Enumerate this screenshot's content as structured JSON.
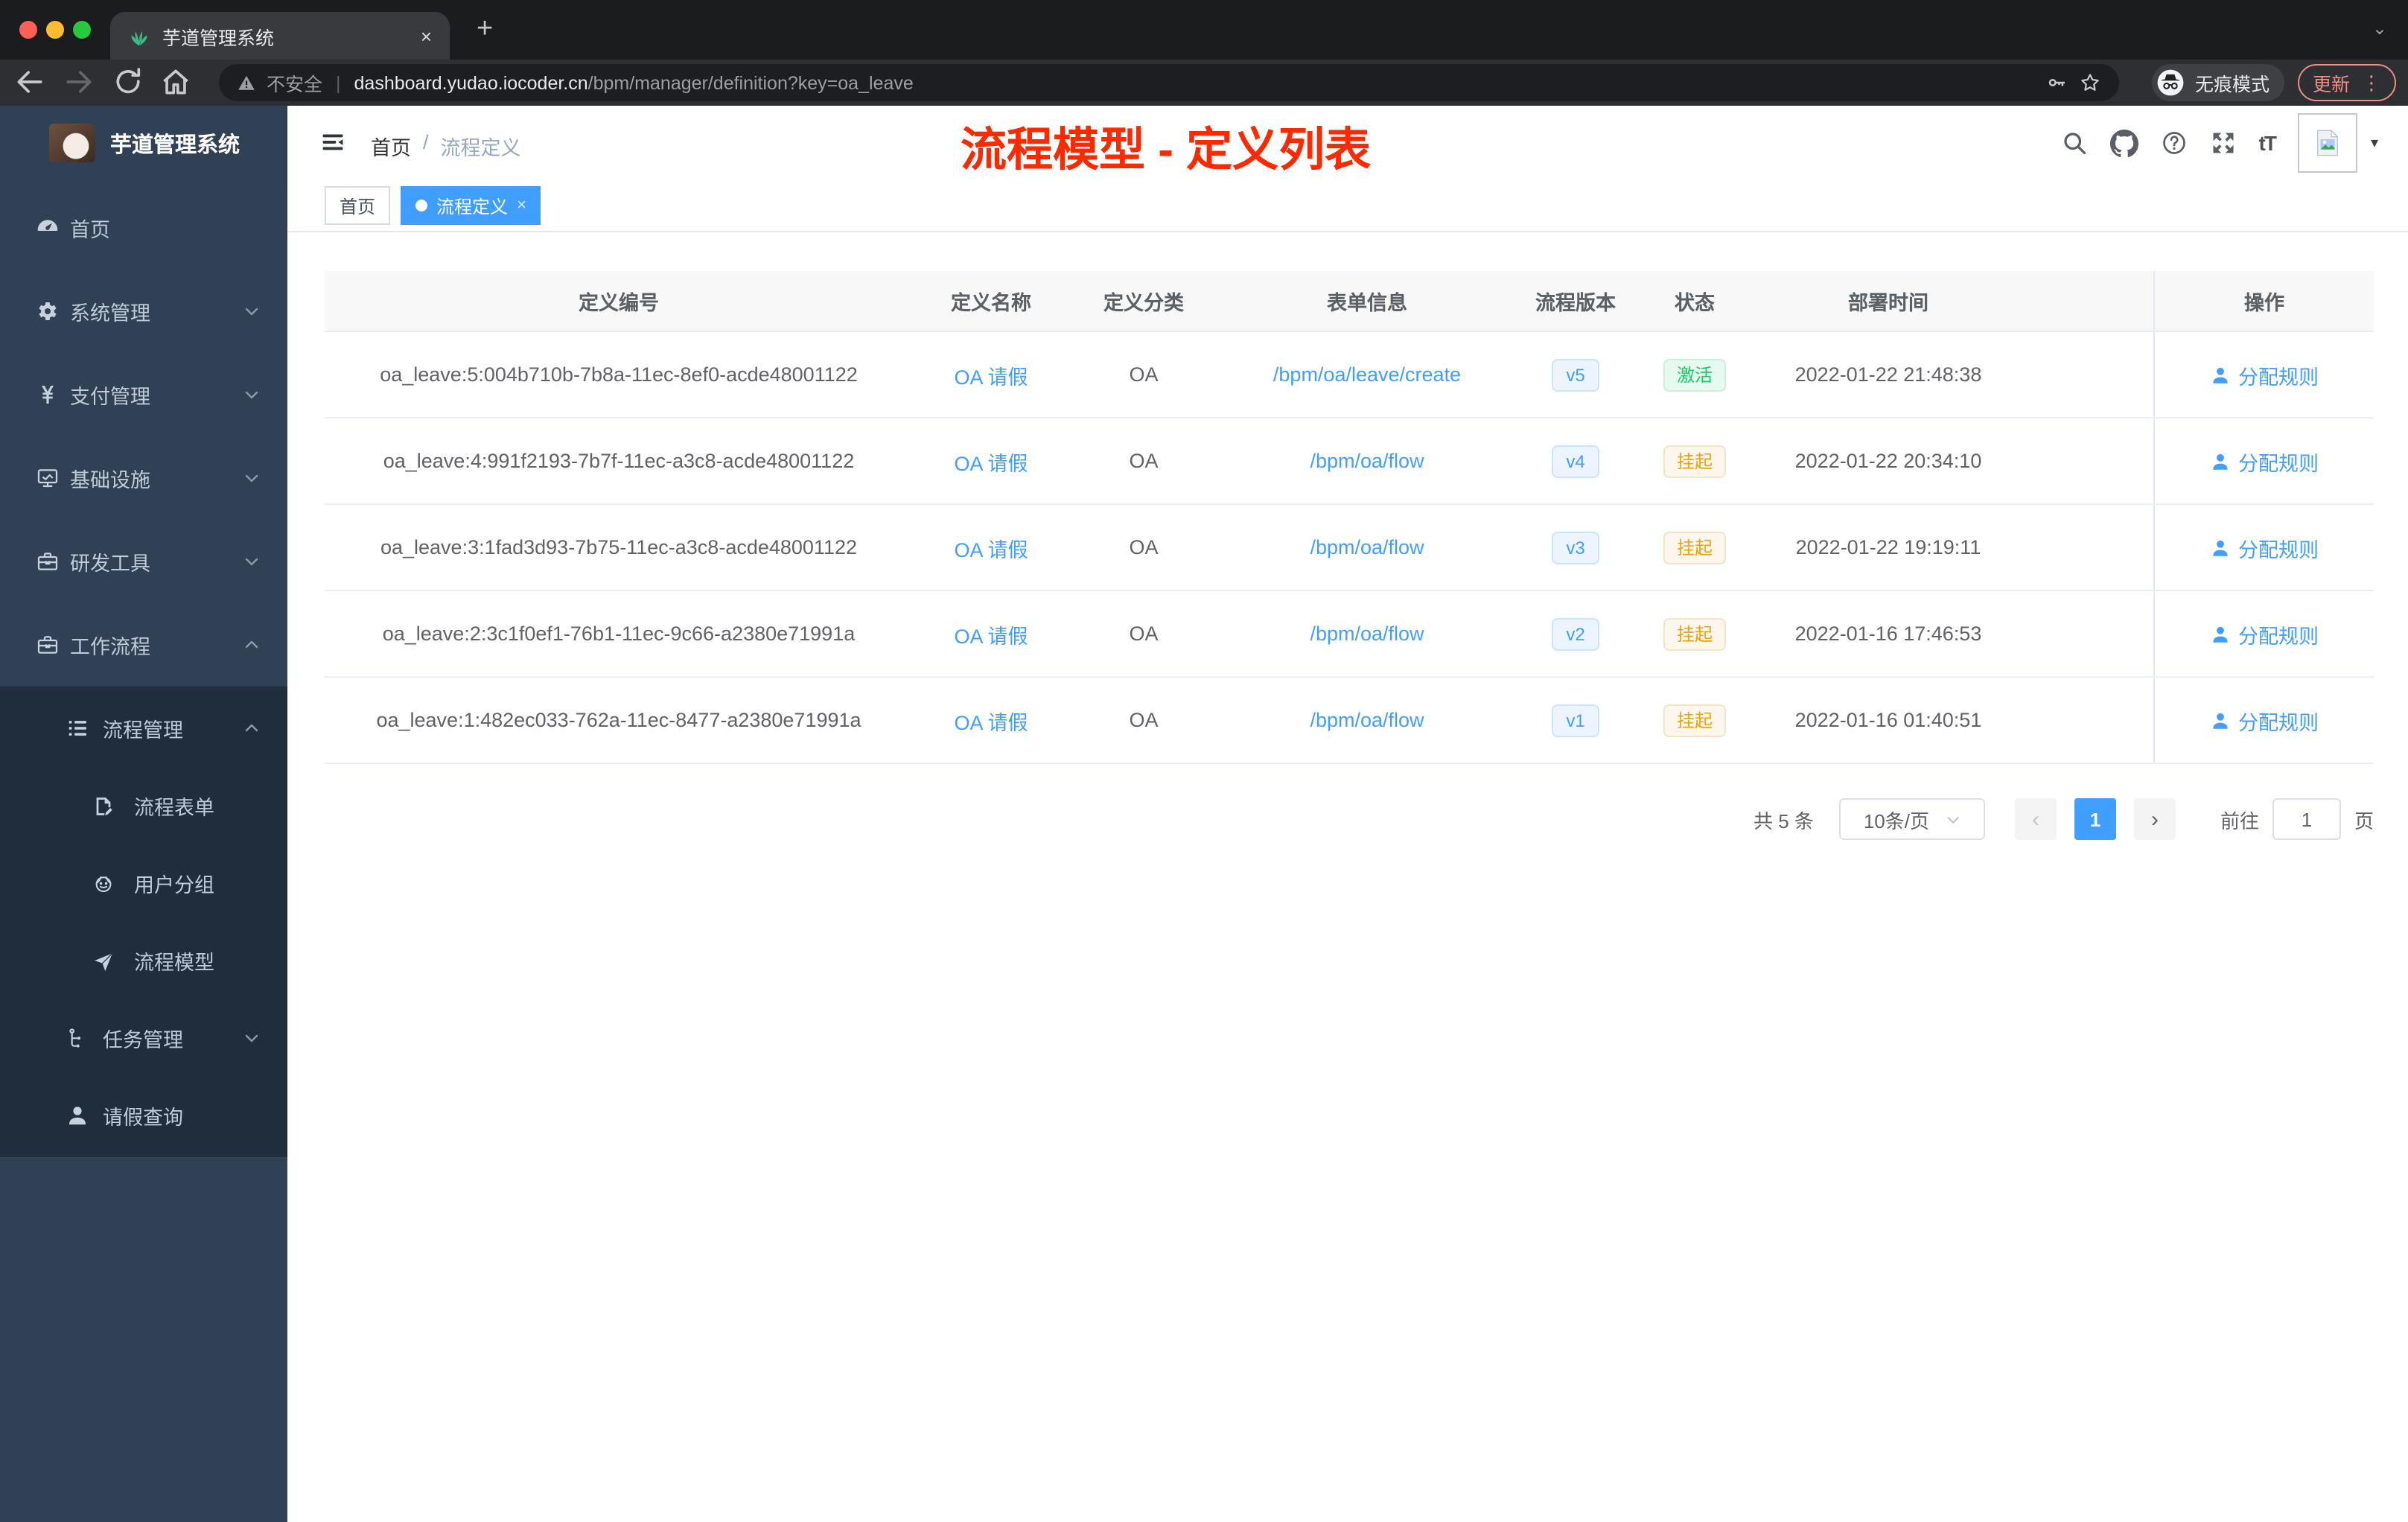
{
  "colors": {
    "accent": "#409eff",
    "annotation_red": "#fb2a00",
    "sidebar_bg": "#304156",
    "submenu_bg": "#1f2d3d",
    "status_active_green": "#13ce66",
    "status_suspend_amber": "#eda408"
  },
  "browser": {
    "tab_title": "芋道管理系统",
    "new_tab_label": "+",
    "close_tab_label": "×",
    "security_label": "不安全",
    "url_host": "dashboard.yudao.iocoder.cn",
    "url_path": "/bpm/manager/definition?key=oa_leave",
    "incognito_label": "无痕模式",
    "update_label": "更新",
    "kebab_label": "⋮",
    "strip_caret": "⌄",
    "icons": {
      "favicon": "plant",
      "back": "back",
      "forward": "forward",
      "reload": "reload",
      "home": "home",
      "warning": "warning",
      "key": "key",
      "star": "star",
      "incognito": "incognito"
    }
  },
  "sidebar": {
    "logo_title": "芋道管理系统",
    "items": [
      {
        "label": "首页",
        "icon": "gauge"
      },
      {
        "label": "系统管理",
        "icon": "gear",
        "arrow": "down"
      },
      {
        "label": "支付管理",
        "icon": "yen",
        "arrow": "down"
      },
      {
        "label": "基础设施",
        "icon": "monitor",
        "arrow": "down"
      },
      {
        "label": "研发工具",
        "icon": "toolbox",
        "arrow": "down"
      },
      {
        "label": "工作流程",
        "icon": "toolbox",
        "arrow": "up"
      },
      {
        "label": "流程管理",
        "icon": "list",
        "arrow": "up"
      },
      {
        "label": "流程表单",
        "icon": "form"
      },
      {
        "label": "用户分组",
        "icon": "group"
      },
      {
        "label": "流程模型",
        "icon": "plane"
      },
      {
        "label": "任务管理",
        "icon": "tree",
        "arrow": "down"
      },
      {
        "label": "请假查询",
        "icon": "user"
      }
    ]
  },
  "header": {
    "breadcrumb_home": "首页",
    "breadcrumb_sep": "/",
    "breadcrumb_current": "流程定义",
    "annotation": "流程模型 - 定义列表",
    "fontsize_label": "tT",
    "nav_caret": "▾",
    "icons": {
      "hamburger": "hamburger",
      "search": "search",
      "github": "github",
      "help": "help",
      "fullscreen": "fullscreen",
      "avatar_broken": "broken-image"
    }
  },
  "tags": [
    {
      "label": "首页"
    },
    {
      "label": "流程定义",
      "close": "×"
    }
  ],
  "table": {
    "columns": [
      "定义编号",
      "定义名称",
      "定义分类",
      "表单信息",
      "流程版本",
      "状态",
      "部署时间",
      "操作"
    ],
    "action_icon": "user",
    "rows": [
      {
        "id": "oa_leave:5:004b710b-7b8a-11ec-8ef0-acde48001122",
        "name": "OA 请假",
        "category": "OA",
        "form": "/bpm/oa/leave/create",
        "version": "v5",
        "status": "激活",
        "status_type": "success",
        "deployed_at": "2022-01-22 21:48:38",
        "action": "分配规则"
      },
      {
        "id": "oa_leave:4:991f2193-7b7f-11ec-a3c8-acde48001122",
        "name": "OA 请假",
        "category": "OA",
        "form": "/bpm/oa/flow",
        "version": "v4",
        "status": "挂起",
        "status_type": "warning",
        "deployed_at": "2022-01-22 20:34:10",
        "action": "分配规则"
      },
      {
        "id": "oa_leave:3:1fad3d93-7b75-11ec-a3c8-acde48001122",
        "name": "OA 请假",
        "category": "OA",
        "form": "/bpm/oa/flow",
        "version": "v3",
        "status": "挂起",
        "status_type": "warning",
        "deployed_at": "2022-01-22 19:19:11",
        "action": "分配规则"
      },
      {
        "id": "oa_leave:2:3c1f0ef1-76b1-11ec-9c66-a2380e71991a",
        "name": "OA 请假",
        "category": "OA",
        "form": "/bpm/oa/flow",
        "version": "v2",
        "status": "挂起",
        "status_type": "warning",
        "deployed_at": "2022-01-16 17:46:53",
        "action": "分配规则"
      },
      {
        "id": "oa_leave:1:482ec033-762a-11ec-8477-a2380e71991a",
        "name": "OA 请假",
        "category": "OA",
        "form": "/bpm/oa/flow",
        "version": "v1",
        "status": "挂起",
        "status_type": "warning",
        "deployed_at": "2022-01-16 01:40:51",
        "action": "分配规则"
      }
    ]
  },
  "pagination": {
    "total": "共 5 条",
    "page_size": "10条/页",
    "prev": "‹",
    "page": "1",
    "next": "›",
    "goto": "前往",
    "unit": "页"
  }
}
